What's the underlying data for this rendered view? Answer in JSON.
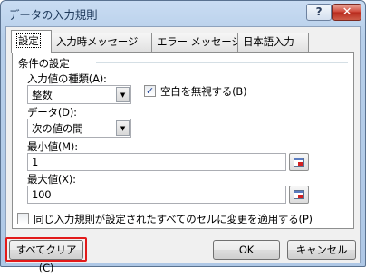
{
  "window": {
    "title": "データの入力規則",
    "help_label": "?",
    "close_label": "✕"
  },
  "tabs": [
    {
      "label": "設定"
    },
    {
      "label": "入力時メッセージ"
    },
    {
      "label": "エラー メッセージ"
    },
    {
      "label": "日本語入力"
    }
  ],
  "settings": {
    "group_label": "条件の設定",
    "type_label": "入力値の種類(A):",
    "type_value": "整数",
    "ignore_blank_label": "空白を無視する(B)",
    "ignore_blank_checked": true,
    "data_label": "データ(D):",
    "data_value": "次の値の間",
    "min_label": "最小値(M):",
    "min_value": "1",
    "max_label": "最大値(X):",
    "max_value": "100",
    "apply_all_label": "同じ入力規則が設定されたすべてのセルに変更を適用する(P)",
    "apply_all_checked": false
  },
  "buttons": {
    "clear_all": "すべてクリア(C)",
    "ok": "OK",
    "cancel": "キャンセル"
  },
  "colors": {
    "highlight": "#e21a1a",
    "title_text": "#1e395b",
    "close_button": "#c83b2d"
  },
  "icons": {
    "dropdown": "chevron-down-icon",
    "range_selector": "range-select-icon",
    "check": "checkmark-icon"
  }
}
